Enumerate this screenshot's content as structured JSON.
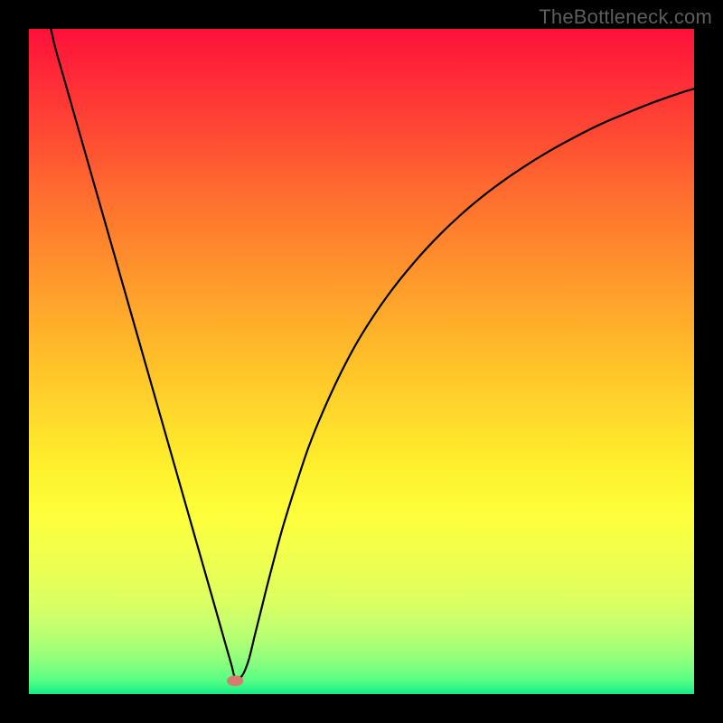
{
  "watermark": "TheBottleneck.com",
  "chart_data": {
    "type": "line",
    "title": "",
    "xlabel": "",
    "ylabel": "",
    "xlim": [
      0,
      100
    ],
    "ylim": [
      0,
      100
    ],
    "series": [
      {
        "name": "bottleneck-curve",
        "x": [
          3.3,
          4,
          5,
          6,
          8,
          10,
          12,
          14,
          16,
          18,
          20,
          22,
          24,
          26,
          28,
          29.5,
          30.5,
          31,
          32,
          33,
          34,
          35,
          36,
          38,
          40,
          42,
          44,
          47,
          50,
          54,
          58,
          62,
          66,
          70,
          74,
          78,
          82,
          86,
          90,
          94,
          98,
          100
        ],
        "y": [
          100,
          97,
          93.5,
          90,
          83,
          76,
          69,
          62,
          55,
          48,
          41,
          34,
          27,
          20,
          13,
          7.7,
          4.2,
          2.5,
          2.7,
          5,
          9,
          13,
          17,
          24.5,
          31,
          37,
          42,
          48.5,
          54,
          60,
          65,
          69.3,
          73,
          76.2,
          79,
          81.5,
          83.7,
          85.7,
          87.4,
          89,
          90.4,
          91
        ]
      }
    ],
    "marker": {
      "x": 31,
      "y": 2.0,
      "color": "#d77a6f"
    },
    "colors": {
      "curve": "#000000",
      "gradient_top": "#ff103a",
      "gradient_bottom": "#14eb85",
      "frame": "#000000"
    }
  }
}
